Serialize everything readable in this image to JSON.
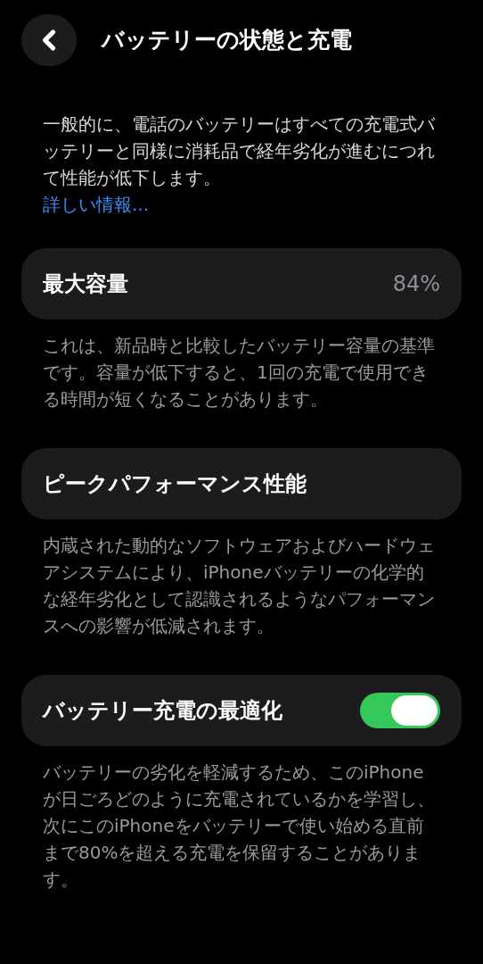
{
  "header": {
    "title": "バッテリーの状態と充電"
  },
  "intro": {
    "text": "一般的に、電話のバッテリーはすべての充電式バッテリーと同様に消耗品で経年劣化が進むにつれて性能が低下します。",
    "link": "詳しい情報..."
  },
  "sections": [
    {
      "kind": "value",
      "label": "最大容量",
      "value": "84%",
      "description": "これは、新品時と比較したバッテリー容量の基準です。容量が低下すると、1回の充電で使用できる時間が短くなることがあります。"
    },
    {
      "kind": "plain",
      "label": "ピークパフォーマンス性能",
      "description": "内蔵された動的なソフトウェアおよびハードウェアシステムにより、iPhoneバッテリーの化学的な経年劣化として認識されるようなパフォーマンスへの影響が低減されます。"
    },
    {
      "kind": "toggle",
      "label": "バッテリー充電の最適化",
      "on": true,
      "description": "バッテリーの劣化を軽減するため、このiPhoneが日ごろどのように充電されているかを学習し、次にこのiPhoneをバッテリーで使い始める直前まで80%を超える充電を保留することがあります。"
    }
  ]
}
